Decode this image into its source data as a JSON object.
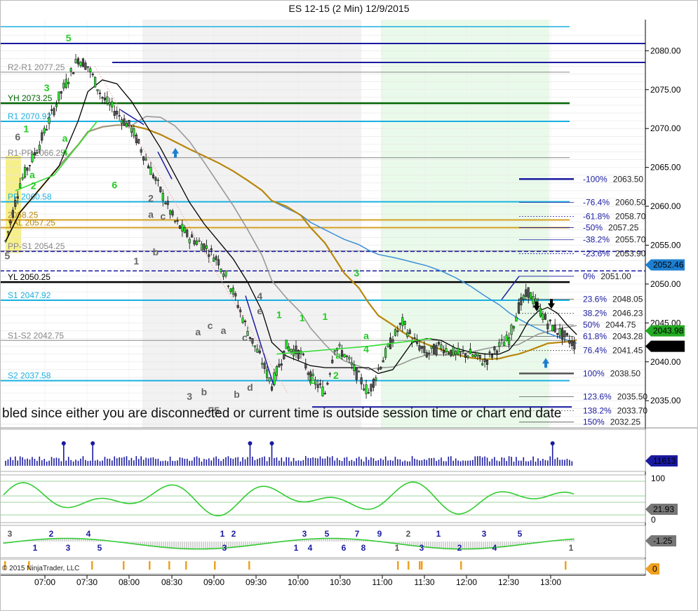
{
  "title": "ES 12-15 (2 Min)  12/9/2015",
  "copyright": "© 2015 NinjaTrader, LLC",
  "overlay_message": "bled since either you are disconnected or current time is outside session time or chart end date",
  "chart_data": {
    "type": "candlestick",
    "instrument": "ES 12-15",
    "interval": "2 Min",
    "date": "12/9/2015",
    "x_ticks": [
      "07:00",
      "07:30",
      "08:00",
      "08:30",
      "09:00",
      "09:30",
      "10:00",
      "10:30",
      "11:00",
      "11:30",
      "12:00",
      "12:30",
      "13:00"
    ],
    "y_ticks": [
      "2080.00",
      "2075.00",
      "2070.00",
      "2065.00",
      "2060.00",
      "2055.00",
      "2050.00",
      "2045.00",
      "2040.00",
      "2035.00"
    ],
    "ylim": [
      2031.5,
      2084.0
    ],
    "price_path": [
      [
        0,
        2055.5
      ],
      [
        6,
        2063
      ],
      [
        14,
        2068
      ],
      [
        22,
        2074
      ],
      [
        30,
        2079
      ],
      [
        34,
        2078
      ],
      [
        40,
        2074
      ],
      [
        46,
        2072
      ],
      [
        52,
        2070
      ],
      [
        58,
        2066
      ],
      [
        64,
        2062
      ],
      [
        70,
        2058
      ],
      [
        76,
        2056
      ],
      [
        82,
        2055
      ],
      [
        88,
        2053
      ],
      [
        94,
        2049
      ],
      [
        100,
        2044
      ],
      [
        106,
        2040
      ],
      [
        110,
        2037
      ],
      [
        116,
        2042
      ],
      [
        122,
        2041
      ],
      [
        126,
        2038
      ],
      [
        132,
        2036
      ],
      [
        136,
        2042
      ],
      [
        140,
        2041
      ],
      [
        146,
        2038
      ],
      [
        150,
        2036
      ],
      [
        154,
        2039
      ],
      [
        160,
        2043
      ],
      [
        164,
        2045
      ],
      [
        168,
        2043
      ],
      [
        174,
        2041
      ],
      [
        180,
        2042
      ],
      [
        186,
        2041
      ],
      [
        192,
        2041
      ],
      [
        198,
        2040
      ],
      [
        204,
        2042
      ],
      [
        208,
        2043
      ],
      [
        212,
        2047
      ],
      [
        216,
        2049
      ],
      [
        220,
        2047
      ],
      [
        224,
        2045
      ],
      [
        228,
        2044
      ],
      [
        232,
        2043
      ],
      [
        236,
        2042
      ]
    ],
    "levels": [
      {
        "label": "R2-R1 2077.25",
        "value": 2077.25,
        "color": "#888888"
      },
      {
        "label": "YH 2073.25",
        "value": 2073.25,
        "color": "#006400"
      },
      {
        "label": "R1 2070.92",
        "value": 2070.92,
        "color": "#1ab0e0"
      },
      {
        "label": "R1-PP 2066.25",
        "value": 2066.25,
        "color": "#888888"
      },
      {
        "label": "PP 2060.58",
        "value": 2060.58,
        "color": "#1ab0e0"
      },
      {
        "label": "2058.25",
        "value": 2058.25,
        "color": "#d4a020"
      },
      {
        "label": "VAL 2057.25",
        "value": 2057.25,
        "color": "#d4a020"
      },
      {
        "label": "PP-S1 2054.25",
        "value": 2054.25,
        "color": "#888888"
      },
      {
        "label": "YL 2050.25",
        "value": 2050.25,
        "color": "#000000"
      },
      {
        "label": "S1 2047.92",
        "value": 2047.92,
        "color": "#1ab0e0"
      },
      {
        "label": "S1-S2 2042.75",
        "value": 2042.75,
        "color": "#888888"
      },
      {
        "label": "S2 2037.58",
        "value": 2037.58,
        "color": "#1ab0e0"
      }
    ],
    "fib_levels": [
      {
        "label": "-100%",
        "value": 2063.5
      },
      {
        "label": "-76.4%",
        "value": 2060.5
      },
      {
        "label": "-61.8%",
        "value": 2058.7
      },
      {
        "label": "-50%",
        "value": 2057.25
      },
      {
        "label": "-38.2%",
        "value": 2055.7
      },
      {
        "label": "-23.6%",
        "value": 2053.9
      },
      {
        "label": "0%",
        "value": 2051.0
      },
      {
        "label": "23.6%",
        "value": 2048.05
      },
      {
        "label": "38.2%",
        "value": 2046.23
      },
      {
        "label": "50%",
        "value": 2044.75
      },
      {
        "label": "61.8%",
        "value": 2043.28
      },
      {
        "label": "76.4%",
        "value": 2041.45
      },
      {
        "label": "100%",
        "value": 2038.5
      },
      {
        "label": "123.6%",
        "value": 2035.5
      },
      {
        "label": "138.2%",
        "value": 2033.7
      },
      {
        "label": "150%",
        "value": 2032.25
      }
    ],
    "price_markers": [
      {
        "label": "2052.46",
        "value": 2052.46,
        "color": "#1e7fd0"
      },
      {
        "label": "2043.98",
        "value": 2043.98,
        "color": "#22aa22"
      },
      {
        "label": "2042.00",
        "value": 2042.0,
        "color": "#000000"
      }
    ],
    "wave_labels": [
      {
        "t": "5",
        "x": 0.7,
        "y": 2053.2,
        "c": "#666666"
      },
      {
        "t": "6",
        "x": 5,
        "y": 2068.5,
        "c": "#666666"
      },
      {
        "t": "1",
        "x": 8.5,
        "y": 2069.5,
        "c": "#22cc22"
      },
      {
        "t": "3",
        "x": 17,
        "y": 2074.8,
        "c": "#22cc22"
      },
      {
        "t": "5",
        "x": 26,
        "y": 2081.2,
        "c": "#22cc22"
      },
      {
        "t": "a",
        "x": 24.5,
        "y": 2068.3,
        "c": "#22cc22"
      },
      {
        "t": "4",
        "x": 24.5,
        "y": 2066.5,
        "c": "#22cc22"
      },
      {
        "t": "a",
        "x": 11,
        "y": 2063.6,
        "c": "#22cc22"
      },
      {
        "t": "2",
        "x": 11.5,
        "y": 2062.2,
        "c": "#22cc22"
      },
      {
        "t": "6",
        "x": 45,
        "y": 2062.3,
        "c": "#22cc22"
      },
      {
        "t": "2",
        "x": 60,
        "y": 2060.6,
        "c": "#666666"
      },
      {
        "t": "a",
        "x": 60,
        "y": 2058.5,
        "c": "#666666"
      },
      {
        "t": "c",
        "x": 65,
        "y": 2058.3,
        "c": "#666666"
      },
      {
        "t": "1",
        "x": 54,
        "y": 2052.5,
        "c": "#666666"
      },
      {
        "t": "b",
        "x": 62,
        "y": 2053.7,
        "c": "#666666"
      },
      {
        "t": "3",
        "x": 76,
        "y": 2035.1,
        "c": "#666666"
      },
      {
        "t": "a",
        "x": 79.5,
        "y": 2043.4,
        "c": "#666666"
      },
      {
        "t": "b",
        "x": 82,
        "y": 2035.7,
        "c": "#666666"
      },
      {
        "t": "c",
        "x": 84.5,
        "y": 2044.2,
        "c": "#666666"
      },
      {
        "t": "F5",
        "x": 86,
        "y": 2033.3,
        "c": "#666666"
      },
      {
        "t": "a",
        "x": 90,
        "y": 2043.6,
        "c": "#666666"
      },
      {
        "t": "b",
        "x": 95.5,
        "y": 2035.4,
        "c": "#666666"
      },
      {
        "t": "c",
        "x": 98.8,
        "y": 2042.7,
        "c": "#666666"
      },
      {
        "t": "d",
        "x": 101,
        "y": 2036.3,
        "c": "#666666"
      },
      {
        "t": "4",
        "x": 105,
        "y": 2048.0,
        "c": "#666666"
      },
      {
        "t": "e",
        "x": 105,
        "y": 2046.1,
        "c": "#666666"
      },
      {
        "t": "1",
        "x": 113,
        "y": 2045.6,
        "c": "#22cc22"
      },
      {
        "t": "1",
        "x": 122.5,
        "y": 2045.2,
        "c": "#22cc22"
      },
      {
        "t": "1",
        "x": 132,
        "y": 2045.4,
        "c": "#22cc22"
      },
      {
        "t": "2",
        "x": 126.5,
        "y": 2037.2,
        "c": "#22cc22"
      },
      {
        "t": "a",
        "x": 137.5,
        "y": 2040.4,
        "c": "#22cc22"
      },
      {
        "t": "2",
        "x": 136.5,
        "y": 2037.8,
        "c": "#22cc22"
      },
      {
        "t": "3",
        "x": 145,
        "y": 2051.0,
        "c": "#22cc22"
      },
      {
        "t": "a",
        "x": 149,
        "y": 2042.9,
        "c": "#22cc22"
      },
      {
        "t": "4",
        "x": 149,
        "y": 2041.2,
        "c": "#22cc22"
      }
    ]
  },
  "volume_panel": {
    "marker": "11613"
  },
  "oscillator_panel": {
    "ticks": [
      "100",
      "0"
    ],
    "marker": "21.93"
  },
  "macd_panel": {
    "marker": "-1.25",
    "labels": [
      "3",
      "1",
      "2",
      "3",
      "4",
      "5",
      "1",
      "3",
      "2",
      "1",
      "3",
      "4",
      "5",
      "6",
      "7",
      "8",
      "9",
      "1",
      "2",
      "3",
      "1",
      "2",
      "3",
      "4",
      "5",
      "1"
    ]
  },
  "bar_panel": {
    "marker": "0"
  }
}
